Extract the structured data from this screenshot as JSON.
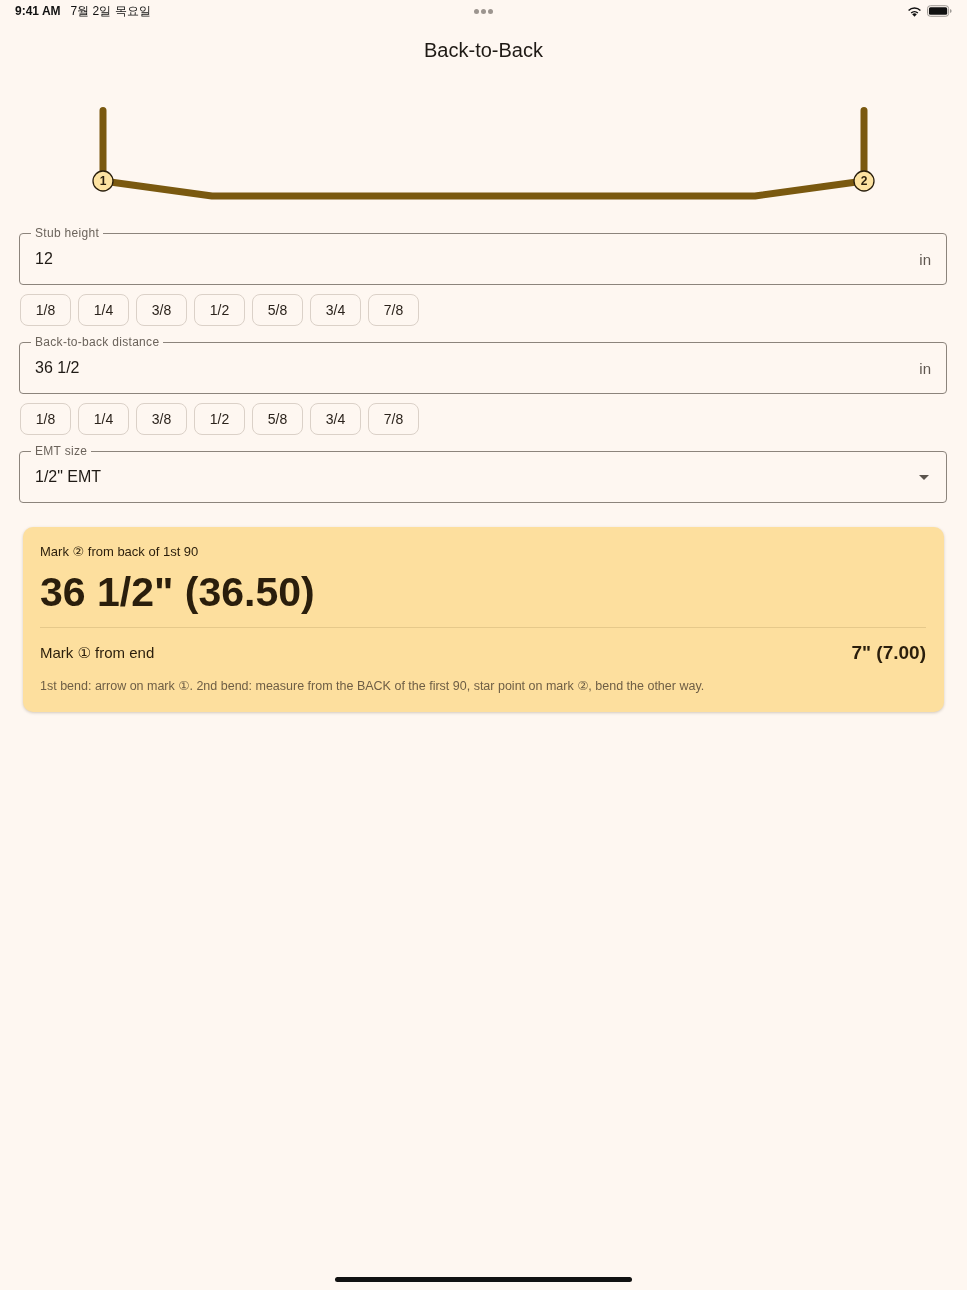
{
  "status_bar": {
    "time": "9:41 AM",
    "date": "7월 2일 목요일"
  },
  "title": "Back-to-Back",
  "diagram": {
    "markers": [
      "1",
      "2"
    ]
  },
  "inputs": [
    {
      "kind": "number",
      "label": "Stub height",
      "value": "12",
      "unit": "in",
      "fractions": [
        "1/8",
        "1/4",
        "3/8",
        "1/2",
        "5/8",
        "3/4",
        "7/8"
      ]
    },
    {
      "kind": "number",
      "label": "Back-to-back distance",
      "value": "36 1/2",
      "unit": "in",
      "fractions": [
        "1/8",
        "1/4",
        "3/8",
        "1/2",
        "5/8",
        "3/4",
        "7/8"
      ]
    },
    {
      "kind": "select",
      "label": "EMT size",
      "value": "1/2\" EMT"
    }
  ],
  "result": {
    "primary": {
      "label": "Mark ② from back of 1st 90",
      "value": "36 1/2\" (36.50)"
    },
    "secondary": {
      "label": "Mark ① from end",
      "value": "7\" (7.00)"
    },
    "note": "1st bend: arrow on mark ①. 2nd bend: measure from the BACK of the first 90, star point on mark ②, bend the other way."
  }
}
